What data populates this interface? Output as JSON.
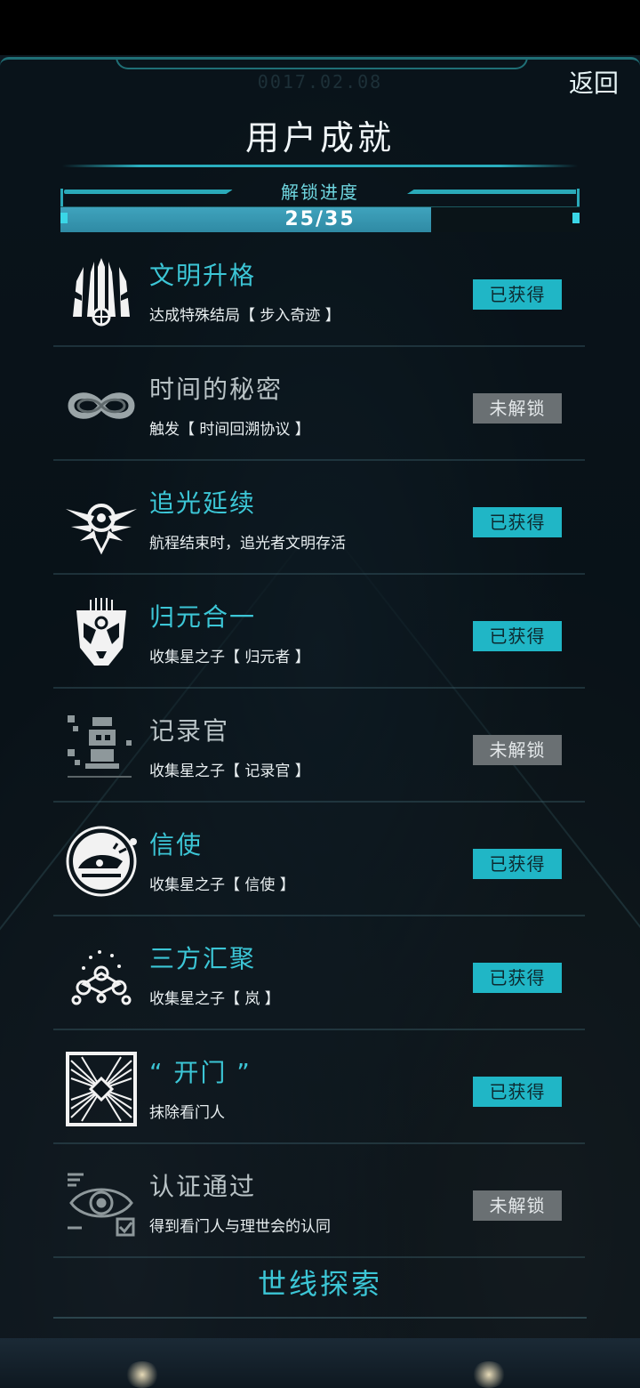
{
  "header": {
    "date": "0017.02.08",
    "back_label": "返回",
    "title": "用户成就"
  },
  "progress": {
    "label": "解锁进度",
    "text": "25/35",
    "fraction": 0.714
  },
  "achievements": [
    {
      "name": "文明升格",
      "desc": "达成特殊结局【 步入奇迹 】",
      "status": "已获得",
      "state": "obtained",
      "icon": "winged-emblem-icon"
    },
    {
      "name": "时间的秘密",
      "desc": "触发【 时间回溯协议 】",
      "status": "未解锁",
      "state": "locked",
      "icon": "infinity-icon"
    },
    {
      "name": "追光延续",
      "desc": "航程结束时，追光者文明存活",
      "status": "已获得",
      "state": "obtained",
      "icon": "light-chaser-icon"
    },
    {
      "name": "归元合一",
      "desc": "收集星之子【 归元者 】",
      "status": "已获得",
      "state": "obtained",
      "icon": "mask-icon"
    },
    {
      "name": "记录官",
      "desc": "收集星之子【 记录官 】",
      "status": "未解锁",
      "state": "locked",
      "icon": "recorder-icon"
    },
    {
      "name": "信使",
      "desc": "收集星之子【 信使 】",
      "status": "已获得",
      "state": "obtained",
      "icon": "messenger-ship-icon"
    },
    {
      "name": "三方汇聚",
      "desc": "收集星之子【 岚 】",
      "status": "已获得",
      "state": "obtained",
      "icon": "constellation-icon"
    },
    {
      "name": "“ 开门 ”",
      "desc": "抹除看门人",
      "status": "已获得",
      "state": "obtained",
      "icon": "gate-icon"
    },
    {
      "name": "认证通过",
      "desc": "得到看门人与理世会的认同",
      "status": "未解锁",
      "state": "locked",
      "icon": "eye-certification-icon"
    }
  ],
  "footer": {
    "explore_label": "世线探索"
  },
  "colors": {
    "accent": "#3cc6d6",
    "badge_obtained": "#20b6c6",
    "badge_locked": "#6a7073"
  }
}
